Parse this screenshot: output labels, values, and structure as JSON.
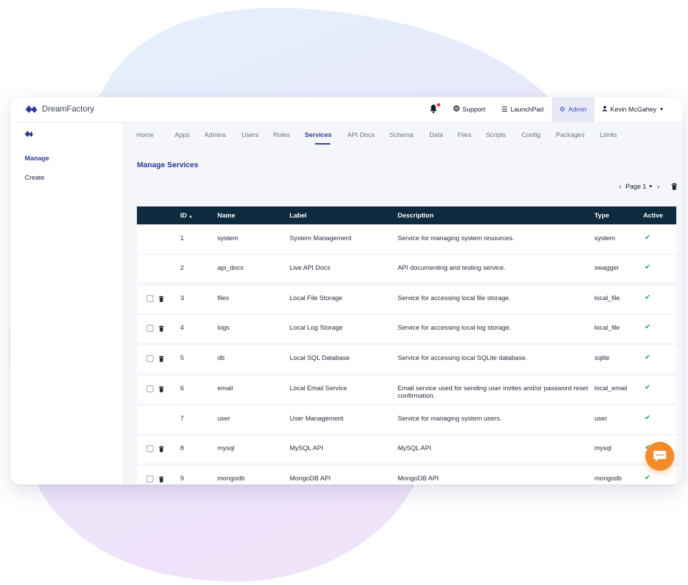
{
  "app": {
    "brand": "DreamFactory"
  },
  "topbar": {
    "support": "Support",
    "launchpad": "LaunchPad",
    "admin": "Admin",
    "user": "Kevin McGahey"
  },
  "sidebar": {
    "items": [
      {
        "label": "Manage"
      },
      {
        "label": "Create"
      }
    ]
  },
  "tabs": [
    "Home",
    "Apps",
    "Admins",
    "Users",
    "Roles",
    "Services",
    "API Docs",
    "Schema",
    "Data",
    "Files",
    "Scripts",
    "Config",
    "Packages",
    "Limits"
  ],
  "active_tab": "Services",
  "page": {
    "title": "Manage Services",
    "pager_label": "Page 1"
  },
  "table": {
    "columns": {
      "id": "ID",
      "name": "Name",
      "label": "Label",
      "description": "Description",
      "type": "Type",
      "active": "Active"
    },
    "sort_indicator": "▲",
    "rows": [
      {
        "id": "1",
        "name": "system",
        "label": "System Management",
        "description": "Service for managing system resources.",
        "type": "system",
        "deletable": false
      },
      {
        "id": "2",
        "name": "api_docs",
        "label": "Live API Docs",
        "description": "API documenting and testing service.",
        "type": "swagger",
        "deletable": false
      },
      {
        "id": "3",
        "name": "files",
        "label": "Local File Storage",
        "description": "Service for accessing local file storage.",
        "type": "local_file",
        "deletable": true
      },
      {
        "id": "4",
        "name": "logs",
        "label": "Local Log Storage",
        "description": "Service for accessing local log storage.",
        "type": "local_file",
        "deletable": true
      },
      {
        "id": "5",
        "name": "db",
        "label": "Local SQL Database",
        "description": "Service for accessing local SQLite database.",
        "type": "sqlite",
        "deletable": true
      },
      {
        "id": "6",
        "name": "email",
        "label": "Local Email Service",
        "description": "Email service used for sending user invites and/or password reset confirmation.",
        "type": "local_email",
        "deletable": true
      },
      {
        "id": "7",
        "name": "user",
        "label": "User Management",
        "description": "Service for managing system users.",
        "type": "user",
        "deletable": false
      },
      {
        "id": "8",
        "name": "mysql",
        "label": "MySQL API",
        "description": "MySQL API",
        "type": "mysql",
        "deletable": true
      },
      {
        "id": "9",
        "name": "mongodb",
        "label": "MongoDB API",
        "description": "MongoDB API",
        "type": "mongodb",
        "deletable": true
      }
    ]
  },
  "colors": {
    "accent": "#2c3a9a",
    "table_header": "#0e2a3f",
    "active_check": "#16a34a",
    "chat": "#f58a2a"
  },
  "icons": {
    "notifications": "bell-icon",
    "support": "lifebuoy-icon",
    "launchpad": "menu-icon",
    "admin": "gear-icon",
    "user": "user-icon",
    "delete": "trash-icon",
    "active": "check-icon",
    "chat": "chat-icon"
  }
}
